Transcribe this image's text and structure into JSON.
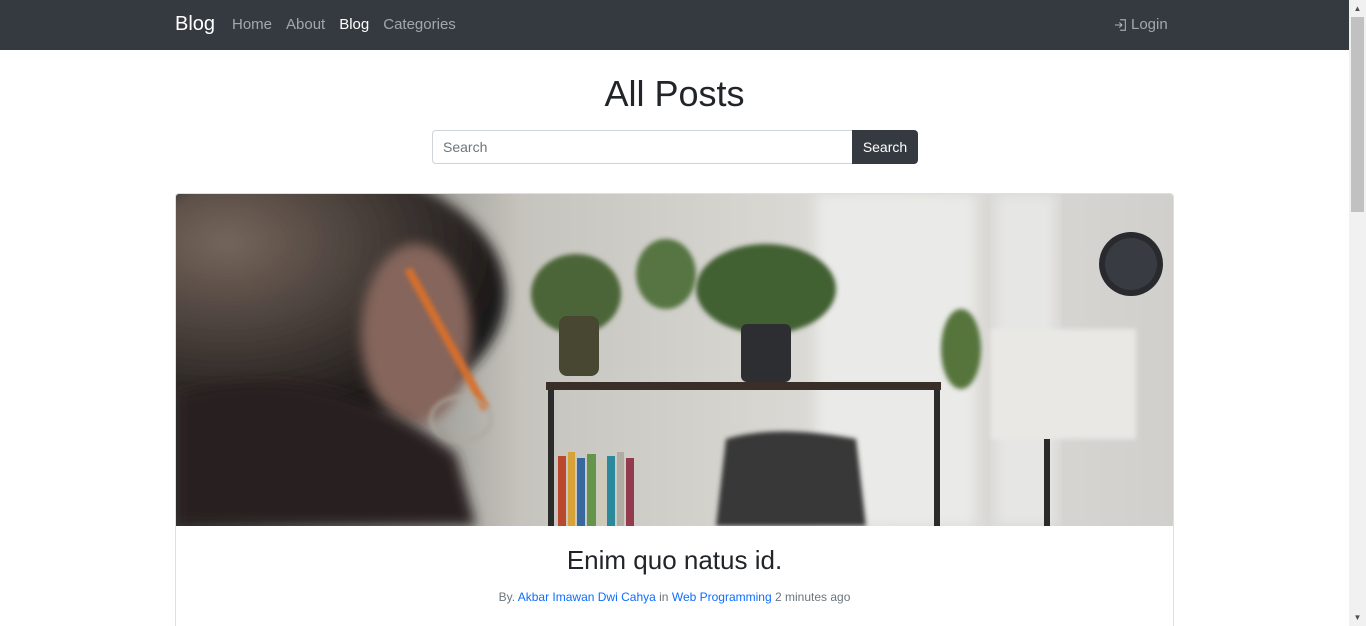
{
  "navbar": {
    "brand": "Blog",
    "links": [
      {
        "label": "Home",
        "active": false
      },
      {
        "label": "About",
        "active": false
      },
      {
        "label": "Blog",
        "active": true
      },
      {
        "label": "Categories",
        "active": false
      }
    ],
    "login_label": "Login",
    "login_icon": "login-icon"
  },
  "page": {
    "title": "All Posts"
  },
  "search": {
    "placeholder": "Search",
    "value": "",
    "button_label": "Search"
  },
  "post": {
    "title": "Enim quo natus id.",
    "by_prefix": "By.",
    "author": "Akbar Imawan Dwi Cahya",
    "in_word": "in",
    "category": "Web Programming",
    "time": "2 minutes ago"
  },
  "colors": {
    "navbar_bg": "#343a40",
    "link": "#0d6efd",
    "button_bg": "#343a40"
  }
}
